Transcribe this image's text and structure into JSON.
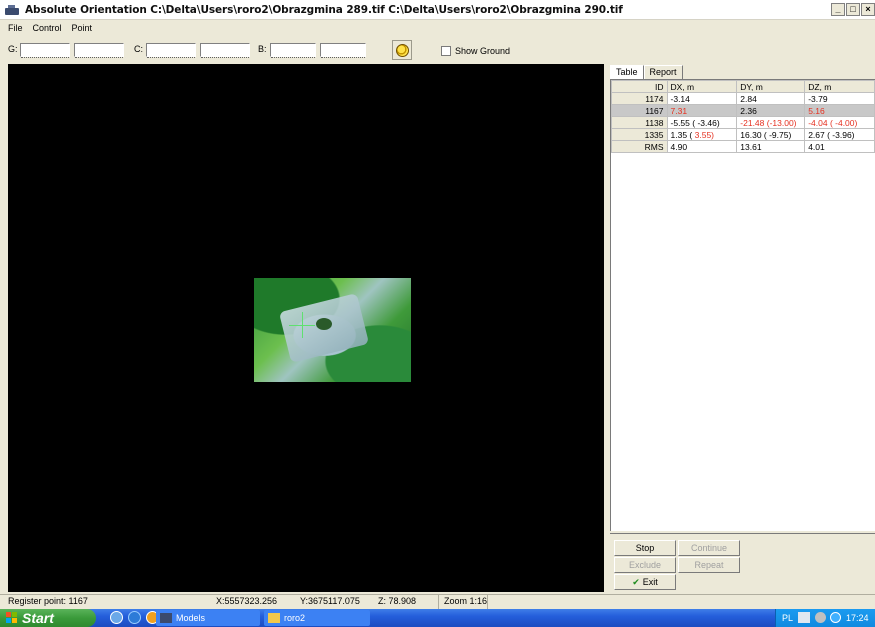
{
  "window": {
    "title": "Absolute Orientation  C:\\Delta\\Users\\roro2\\Obrazgmina 289.tif C:\\Delta\\Users\\roro2\\Obrazgmina 290.tif",
    "minimize": "_",
    "maximize": "□",
    "close": "×"
  },
  "menu": [
    "File",
    "Control",
    "Point"
  ],
  "toolbar": {
    "g_label": "G:",
    "c_label": "C:",
    "b_label": "B:",
    "show_ground": "Show Ground",
    "show_ground_checked": false
  },
  "tabs": [
    "Table",
    "Report"
  ],
  "table": {
    "headers": [
      "ID",
      "DX, m",
      "DY, m",
      "DZ, m"
    ],
    "rows": [
      {
        "id": "1174",
        "dx": "-3.14",
        "dy": "2.84",
        "dz": "-3.79"
      },
      {
        "id": "1167",
        "dx": "7.31",
        "dy": "2.36",
        "dz": "5.16"
      },
      {
        "id": "1138",
        "dx": "-5.55  ( -3.46)",
        "dy": "-21.48 (-13.00)",
        "dz": "-4.04  ( -4.00)"
      },
      {
        "id": "1335",
        "dx_a": "1.35  (",
        "dx_b": "3.55)",
        "dy": "16.30  ( -9.75)",
        "dz": "2.67  ( -3.96)"
      },
      {
        "id": "RMS",
        "dx": "4.90",
        "dy": "13.61",
        "dz": "4.01"
      }
    ]
  },
  "buttons": {
    "stop": "Stop",
    "continue": "Continue",
    "exclude": "Exclude",
    "repeat": "Repeat",
    "exit": "Exit"
  },
  "status": {
    "message": "Register point: 1167",
    "x": "X:5557323.256",
    "y": "Y:3675117.075",
    "z": "Z:    78.908",
    "zoom": "Zoom 1:16"
  },
  "taskbar": {
    "start": "Start",
    "items": [
      "Models",
      "roro2"
    ],
    "lang": "PL",
    "time": "17:24"
  },
  "colors": {
    "viewport": "#000000",
    "red_value": "#e53020",
    "taskbar": "#245edb",
    "start": "#3a9a3a"
  }
}
